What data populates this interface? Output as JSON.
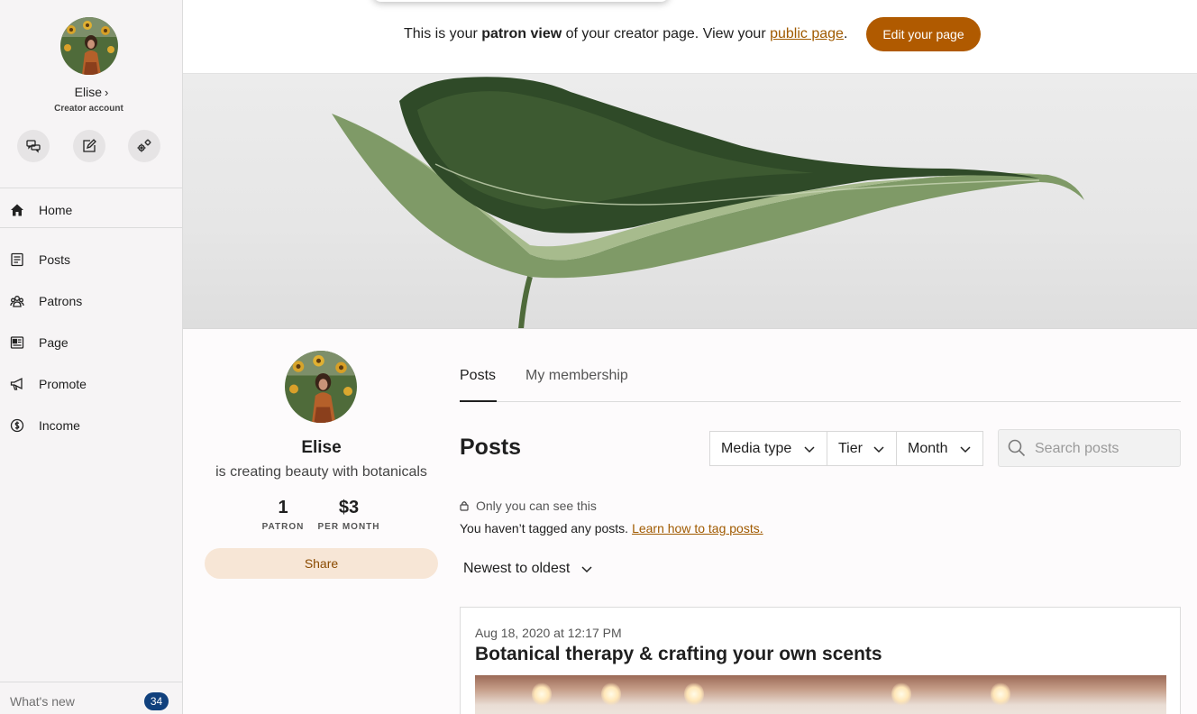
{
  "sidebar": {
    "user_name": "Elise",
    "account_type": "Creator account",
    "quick_actions": [
      {
        "icon": "messages-icon"
      },
      {
        "icon": "edit-icon"
      },
      {
        "icon": "settings-icon"
      }
    ],
    "nav": [
      {
        "label": "Home",
        "icon": "home-icon"
      },
      {
        "label": "Posts",
        "icon": "posts-icon"
      },
      {
        "label": "Patrons",
        "icon": "patrons-icon"
      },
      {
        "label": "Page",
        "icon": "page-icon"
      },
      {
        "label": "Promote",
        "icon": "megaphone-icon"
      },
      {
        "label": "Income",
        "icon": "dollar-icon"
      }
    ],
    "whats_new_label": "What's new",
    "whats_new_count": "34"
  },
  "banner": {
    "text_before": "This is your ",
    "text_bold": "patron view",
    "text_middle": " of your creator page. View your ",
    "link_text": "public page",
    "text_after": ".",
    "edit_button": "Edit your page"
  },
  "profile": {
    "name": "Elise",
    "tagline": "is creating beauty with botanicals",
    "stats": [
      {
        "value": "1",
        "label": "PATRON"
      },
      {
        "value": "$3",
        "label": "PER MONTH"
      }
    ],
    "share_button": "Share"
  },
  "main": {
    "tabs": [
      {
        "label": "Posts",
        "active": true
      },
      {
        "label": "My membership",
        "active": false
      }
    ],
    "title": "Posts",
    "filters": [
      {
        "label": "Media type"
      },
      {
        "label": "Tier"
      },
      {
        "label": "Month"
      }
    ],
    "search_placeholder": "Search posts",
    "visibility_note": "Only you can see this",
    "untagged_text": "You haven’t tagged any posts.",
    "untagged_link": "Learn how to tag posts.",
    "sort_label": "Newest to oldest",
    "post": {
      "date": "Aug 18, 2020 at 12:17 PM",
      "title": "Botanical therapy & crafting your own scents"
    }
  },
  "colors": {
    "accent": "#b05a00",
    "link": "#a05a00",
    "badge": "#11417d",
    "share_bg": "#f7e6d6"
  }
}
